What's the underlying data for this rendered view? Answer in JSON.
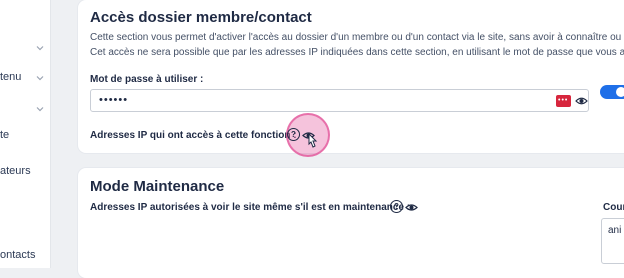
{
  "sidebar": {
    "items": [
      {
        "label": "tenu"
      },
      {
        "label": "te"
      },
      {
        "label": "ateurs"
      },
      {
        "label": "ontacts"
      }
    ]
  },
  "member_access": {
    "title": "Accès dossier membre/contact",
    "desc_line1": "Cette section vous permet d'activer l'accès au dossier d'un membre ou d'un contact via le site, sans avoir à connaître ou à m",
    "desc_line2": "Cet accès ne sera possible que par les adresses IP indiquées dans cette section, en utilisant le mot de passe que vous aurez",
    "password_label": "Mot de passe à utiliser :",
    "password_value": "••••••",
    "pm_badge": "•••",
    "ip_label": "Adresses IP qui ont accès à cette fonction :",
    "help_glyph": "?",
    "toggle_on": true
  },
  "maintenance": {
    "title": "Mode Maintenance",
    "ip_label": "Adresses IP autorisées à voir le site même s'il est en maintenance :",
    "help_glyph": "?",
    "side_label": "Cour",
    "side_value": "ani"
  },
  "colors": {
    "accent": "#1f6fe8",
    "pm_red": "#d7263d",
    "cursor_halo": "#e2549a"
  }
}
